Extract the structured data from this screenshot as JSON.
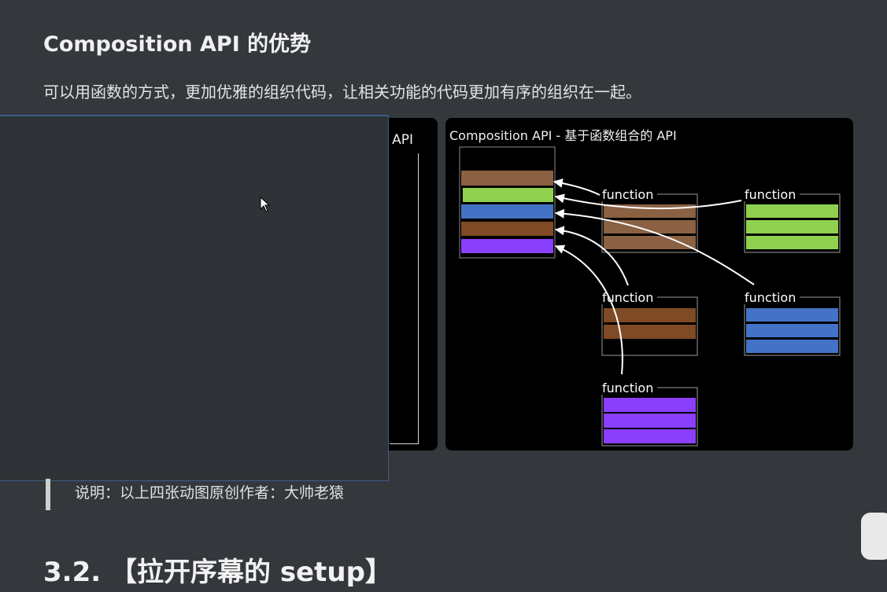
{
  "article": {
    "heading": "Composition API 的优势",
    "intro": "可以用函数的方式，更加优雅的组织代码，让相关功能的代码更加有序的组织在一起。",
    "note": "说明：以上四张动图原创作者：大帅老猿",
    "section_title": "3.2. 【拉开序幕的 setup】"
  },
  "left_figure": {
    "partial_title": "n API"
  },
  "right_figure": {
    "title": "Composition API - 基于函数组合的 API",
    "function_label": "function",
    "colors": {
      "tan": "#8a6143",
      "green": "#8fd14f",
      "blue": "#4472c4",
      "rust": "#7f4a25",
      "purple": "#8a3ffc"
    }
  }
}
